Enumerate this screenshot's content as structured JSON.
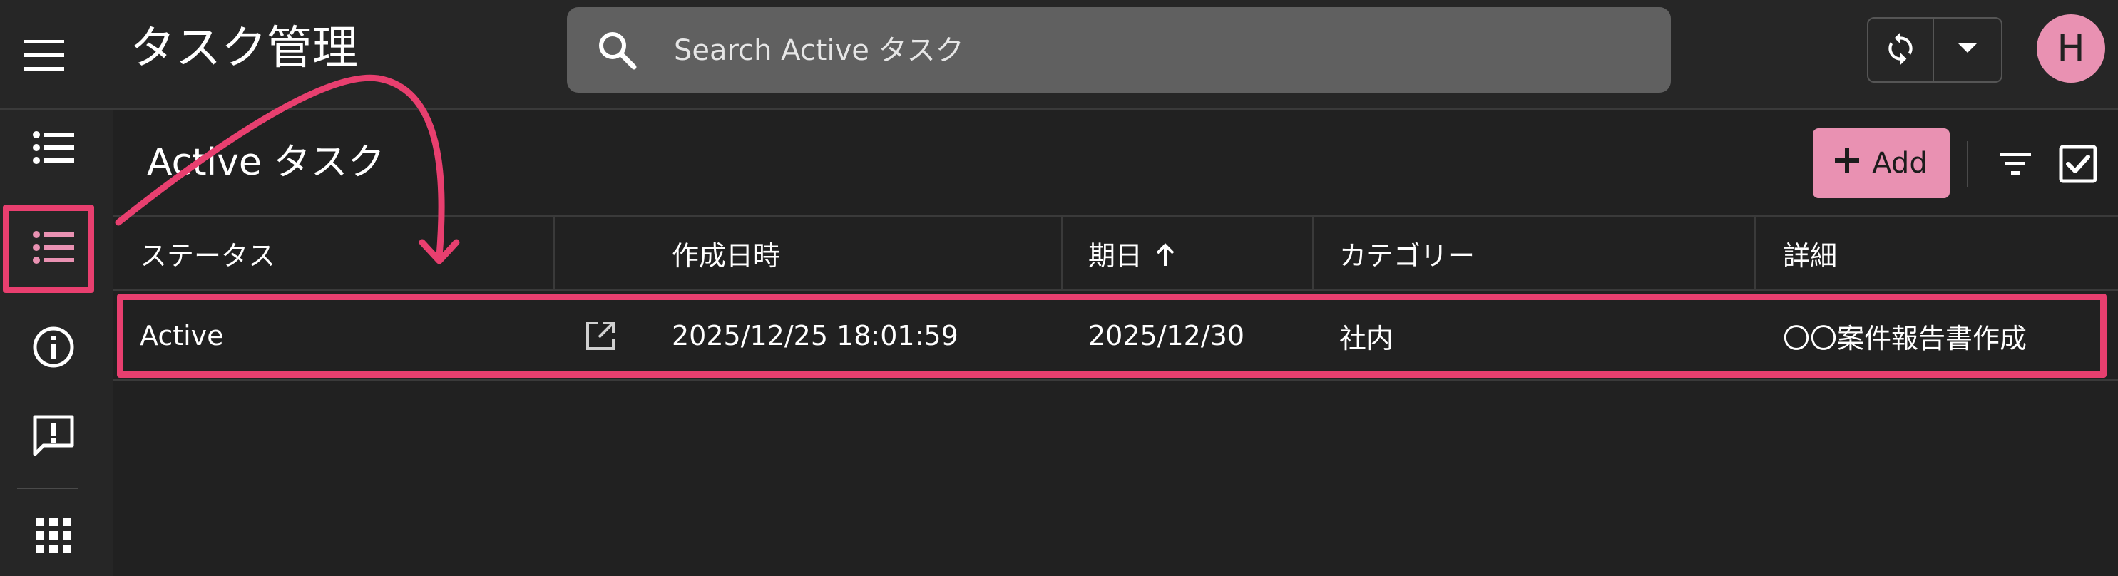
{
  "app": {
    "title": "タスク管理"
  },
  "search": {
    "placeholder": "Search Active タスク"
  },
  "user": {
    "initial": "H"
  },
  "section": {
    "title": "Active タスク"
  },
  "toolbar": {
    "add_label": "Add"
  },
  "table": {
    "headers": {
      "status": "ステータス",
      "created": "作成日時",
      "due": "期日",
      "category": "カテゴリー",
      "detail": "詳細"
    },
    "sort": {
      "column": "期日",
      "direction": "ascending"
    },
    "rows": [
      {
        "status": "Active",
        "created": "2025/12/25 18:01:59",
        "due": "2025/12/30",
        "category": "社内",
        "detail": "〇〇案件報告書作成"
      }
    ]
  },
  "colors": {
    "background": "#212121",
    "accent": "#e991b2",
    "annotation": "#e83f6f",
    "search_bg": "#606060"
  },
  "icons": {
    "top": [
      "menu-icon",
      "search-icon",
      "sync-icon",
      "caret-down-icon"
    ],
    "nav": [
      "list-icon",
      "list-icon",
      "info-icon",
      "feedback-icon",
      "apps-grid-icon"
    ],
    "toolbar": [
      "plus-icon",
      "filter-icon",
      "checkbox-checked-icon"
    ],
    "row": [
      "open-external-icon",
      "sort-arrow-up-icon"
    ]
  }
}
